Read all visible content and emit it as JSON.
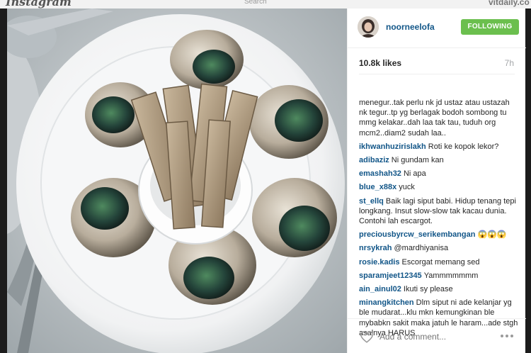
{
  "background": {
    "logo": "Instagram",
    "search": "Search",
    "site": "vitdaily.co"
  },
  "post": {
    "username": "noorneelofa",
    "follow_label": "FOLLOWING",
    "likes": "10.8k likes",
    "time": "7h",
    "caption": "menegur..tak perlu nk jd ustaz atau ustazah nk tegur..tp yg berlagak bodoh sombong tu mmg kelakar..dah laa tak tau, tuduh org mcm2..diam2 sudah laa..",
    "comments": [
      {
        "user": "ikhwanhuzirislakh",
        "text": "Roti ke kopok lekor?"
      },
      {
        "user": "adibaziz",
        "text": "Ni gundam kan"
      },
      {
        "user": "emashah32",
        "text": "Ni apa"
      },
      {
        "user": "blue_x88x",
        "text": "yuck"
      },
      {
        "user": "st_ellq",
        "text": "Baik lagi siput babi. Hidup tenang tepi longkang. Insut slow-slow tak kacau dunia. Contohi lah escargot."
      },
      {
        "user": "preciousbyrcw_serikembangan",
        "text": "😱😱😱"
      },
      {
        "user": "nrsykrah",
        "text": "@mardhiyanisa"
      },
      {
        "user": "rosie.kadis",
        "text": "Escorgat memang sed"
      },
      {
        "user": "sparamjeet12345",
        "text": "Yammmmmmm"
      },
      {
        "user": "ain_ainul02",
        "text": "Ikuti sy please"
      },
      {
        "user": "minangkitchen",
        "text": "Dlm siput ni ade kelanjar yg ble mudarat...klu mkn kemungkinan ble mybabkn sakit maka jatuh le haram...ade stgh asalnya HARUS"
      }
    ],
    "add_comment_placeholder": "Add a comment...",
    "icons": {
      "like": "heart-icon",
      "options": "more-options-icon"
    },
    "colors": {
      "follow": "#6bbf4e",
      "username": "#125688"
    }
  }
}
